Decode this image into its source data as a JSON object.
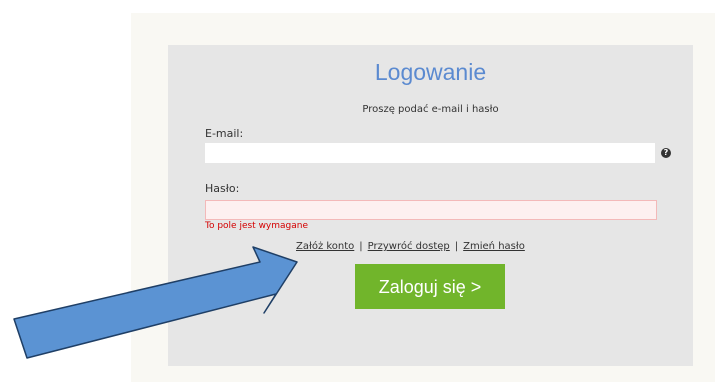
{
  "form": {
    "title": "Logowanie",
    "subtitle": "Proszę podać e-mail i hasło",
    "email_label": "E-mail:",
    "email_value": "",
    "help_glyph": "?",
    "password_label": "Hasło:",
    "password_value": "",
    "error_message": "To pole jest wymagane",
    "links": {
      "register": "Załóż konto",
      "separator": "|",
      "restore": "Przywróć dostęp",
      "change_password": "Zmień hasło"
    },
    "login_button": "Zaloguj się >"
  },
  "icons": {
    "help": "question-circle-icon",
    "annotation": "blue-arrow-icon"
  },
  "colors": {
    "title": "#5b8ad0",
    "button": "#71b52b",
    "error": "#d40000",
    "arrow_fill": "#5b93d3",
    "arrow_stroke": "#1f3f66",
    "panel_bg": "#e6e6e6"
  }
}
